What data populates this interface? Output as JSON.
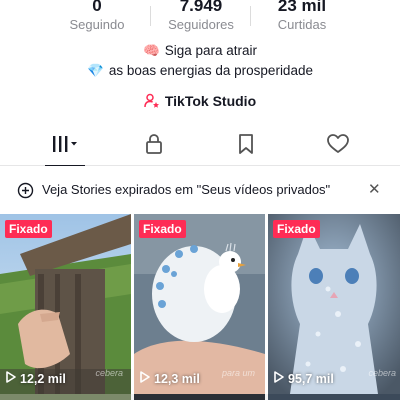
{
  "stats": [
    {
      "value": "0",
      "label": "Seguindo"
    },
    {
      "value": "7.949",
      "label": "Seguidores"
    },
    {
      "value": "23 mil",
      "label": "Curtidas"
    }
  ],
  "bio": {
    "line1_emoji": "🧠",
    "line1": "Siga para atrair",
    "line2_emoji": "💎",
    "line2": "as boas energias da prosperidade"
  },
  "studio_link": {
    "icon": "person-star-icon",
    "label": "TikTok Studio"
  },
  "tabs": [
    {
      "icon": "videos-grid-icon",
      "selected": true
    },
    {
      "icon": "lock-icon",
      "selected": false
    },
    {
      "icon": "bookmark-icon",
      "selected": false
    },
    {
      "icon": "heart-icon",
      "selected": false
    }
  ],
  "notice": {
    "icon": "stories-plus-icon",
    "text": "Veja Stories expirados em \"Seus vídeos privados\"",
    "close_icon": "close-icon"
  },
  "videos": [
    {
      "badge": "Fixado",
      "views": "12,2 mil",
      "caption": "cebera"
    },
    {
      "badge": "Fixado",
      "views": "12,3 mil",
      "caption": "para um"
    },
    {
      "badge": "Fixado",
      "views": "95,7 mil",
      "caption": "cebera"
    }
  ],
  "colors": {
    "accent": "#fe2c55",
    "text": "#161823",
    "muted": "#8a8b91"
  }
}
